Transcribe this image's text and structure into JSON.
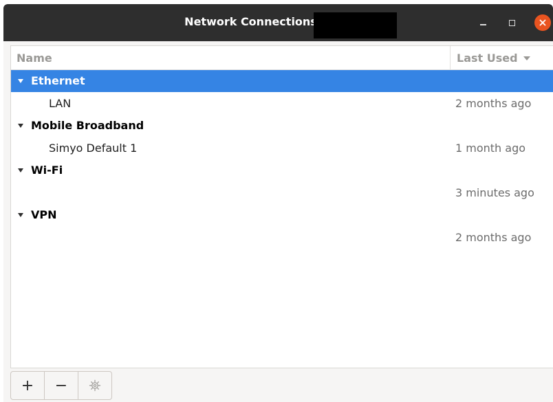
{
  "window": {
    "title": "Network Connections"
  },
  "window_controls": {
    "minimize_icon": "minimize-icon",
    "maximize_icon": "maximize-icon",
    "close_icon": "close-icon",
    "close_color": "#e95420"
  },
  "columns": {
    "name": "Name",
    "last_used": "Last Used"
  },
  "groups": [
    {
      "label": "Ethernet",
      "selected": true,
      "connections": [
        {
          "name": "LAN",
          "last_used": "2 months ago"
        }
      ]
    },
    {
      "label": "Mobile Broadband",
      "selected": false,
      "connections": [
        {
          "name": "Simyo Default 1",
          "last_used": "1 month ago"
        }
      ]
    },
    {
      "label": "Wi-Fi",
      "selected": false,
      "connections": [
        {
          "name": "",
          "last_used": "3 minutes ago"
        }
      ]
    },
    {
      "label": "VPN",
      "selected": false,
      "connections": [
        {
          "name": "",
          "last_used": "2 months ago"
        }
      ]
    }
  ],
  "toolbar": {
    "add_label": "+",
    "remove_label": "−",
    "settings_icon": "gear-icon"
  },
  "colors": {
    "selection": "#3584e4",
    "titlebar": "#2e2e2e"
  }
}
